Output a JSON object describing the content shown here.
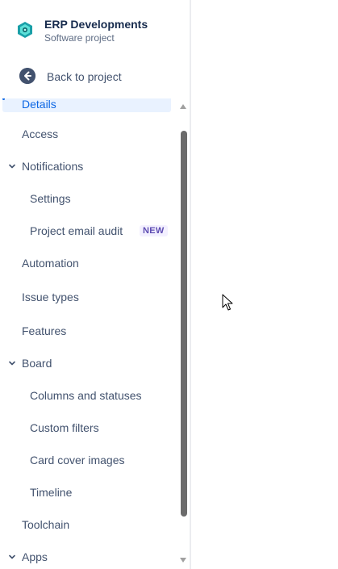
{
  "project": {
    "name": "ERP Developments",
    "type": "Software project"
  },
  "back": {
    "label": "Back to project"
  },
  "nav": {
    "items": [
      {
        "label": "Details"
      },
      {
        "label": "Access"
      },
      {
        "label": "Notifications"
      },
      {
        "label": "Settings"
      },
      {
        "label": "Project email audit",
        "badge": "NEW"
      },
      {
        "label": "Automation"
      },
      {
        "label": "Issue types"
      },
      {
        "label": "Features"
      },
      {
        "label": "Board"
      },
      {
        "label": "Columns and statuses"
      },
      {
        "label": "Custom filters"
      },
      {
        "label": "Card cover images"
      },
      {
        "label": "Timeline"
      },
      {
        "label": "Toolchain"
      },
      {
        "label": "Apps"
      }
    ]
  },
  "colors": {
    "selected_text": "#0c66e4",
    "selected_bg": "#e9f2ff",
    "badge_text": "#5e4db2",
    "nav_text": "#42526e"
  }
}
